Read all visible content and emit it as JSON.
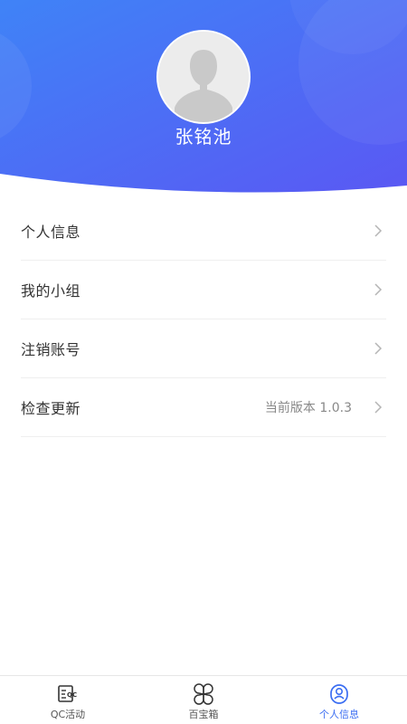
{
  "profile": {
    "name": "张铭池"
  },
  "menu": {
    "items": [
      {
        "label": "个人信息",
        "value": ""
      },
      {
        "label": "我的小组",
        "value": ""
      },
      {
        "label": "注销账号",
        "value": ""
      },
      {
        "label": "检查更新",
        "value": "当前版本 1.0.3"
      }
    ]
  },
  "tabbar": {
    "tabs": [
      {
        "label": "QC活动",
        "icon": "qc-activity-icon",
        "active": false
      },
      {
        "label": "百宝箱",
        "icon": "toolbox-icon",
        "active": false
      },
      {
        "label": "个人信息",
        "icon": "user-icon",
        "active": true
      }
    ]
  },
  "colors": {
    "header_gradient_start": "#3f7cf6",
    "header_gradient_end": "#5d5df4",
    "accent": "#3b6ef2"
  }
}
